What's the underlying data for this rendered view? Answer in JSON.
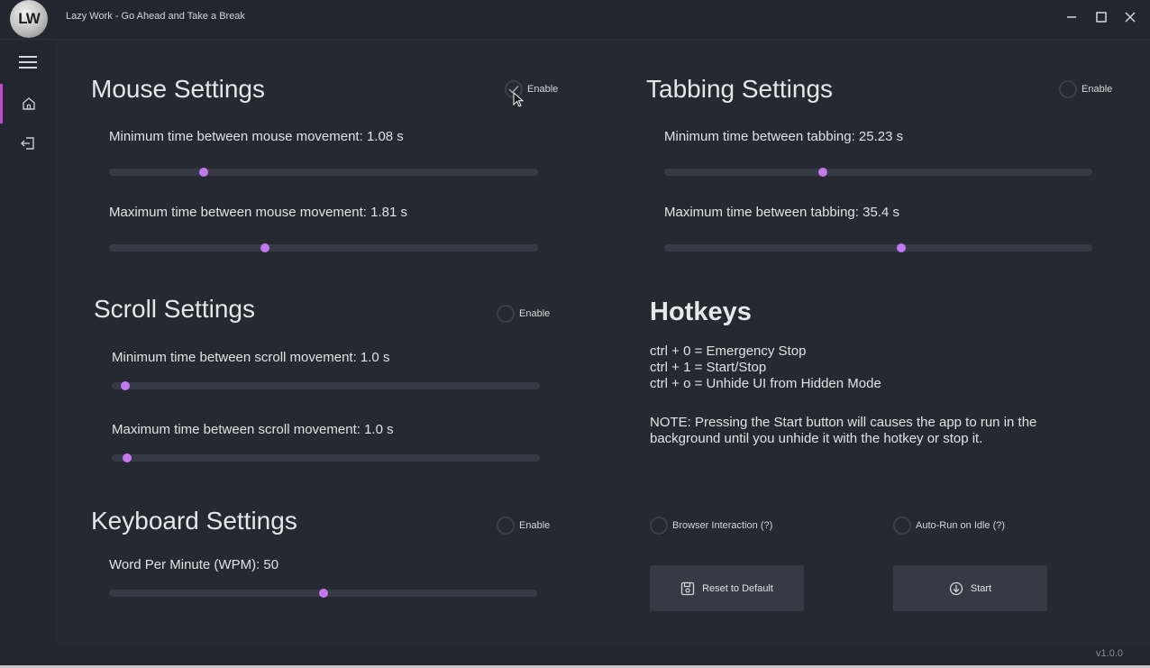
{
  "window": {
    "logo_text": "LW",
    "title": "Lazy Work - Go Ahead and Take a Break",
    "controls": [
      "minimize-icon",
      "maximize-icon",
      "close-icon"
    ]
  },
  "sidebar": {
    "items": [
      {
        "icon": "hamburger-menu-icon"
      },
      {
        "icon": "home-icon",
        "active": true
      },
      {
        "icon": "exit-icon"
      }
    ]
  },
  "mouse": {
    "title": "Mouse Settings",
    "enable_label": "Enable",
    "enabled": true,
    "min_label": "Minimum time between mouse movement: 1.08 s",
    "min_fraction": 0.22,
    "max_label": "Maximum time between mouse movement: 1.81 s",
    "max_fraction": 0.363
  },
  "tabbing": {
    "title": "Tabbing Settings",
    "enable_label": "Enable",
    "enabled": false,
    "min_label": "Minimum time between tabbing: 25.23 s",
    "min_fraction": 0.371,
    "max_label": "Maximum time between tabbing: 35.4 s",
    "max_fraction": 0.553
  },
  "scroll": {
    "title": "Scroll Settings",
    "enable_label": "Enable",
    "enabled": false,
    "min_label": "Minimum time between scroll movement: 1.0 s",
    "min_fraction": 0.032,
    "max_label": "Maximum time between scroll movement: 1.0 s",
    "max_fraction": 0.036
  },
  "keyboard": {
    "title": "Keyboard Settings",
    "enable_label": "Enable",
    "enabled": false,
    "wpm_label": "Word Per Minute (WPM): 50",
    "wpm_fraction": 0.5
  },
  "hotkeys": {
    "title": "Hotkeys",
    "lines": [
      "ctrl + 0 = Emergency Stop",
      "ctrl + 1 = Start/Stop",
      "ctrl + o = Unhide UI from Hidden Mode"
    ],
    "note": "NOTE: Pressing the Start button will causes the app to run in the background until you unhide it with the hotkey or stop it."
  },
  "options": {
    "browser_interaction": "Browser Interaction (?)",
    "auto_run": "Auto-Run on Idle (?)"
  },
  "buttons": {
    "reset": "Reset to Default",
    "start": "Start"
  },
  "footer": {
    "version": "v1.0.0"
  },
  "colors": {
    "background": "#262931",
    "chrome": "#23262e",
    "accent": "#c278ee",
    "active_indicator": "#c04bd0",
    "track": "#353a45"
  }
}
